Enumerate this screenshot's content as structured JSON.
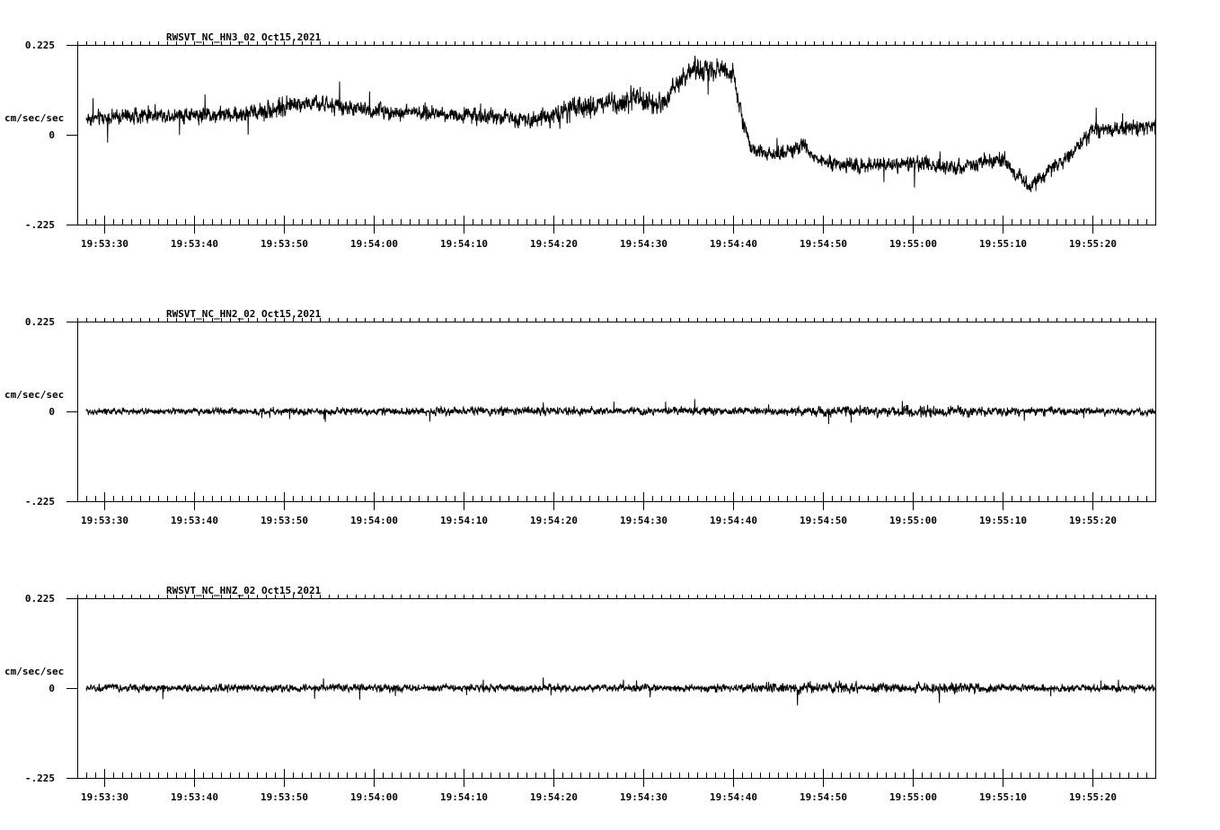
{
  "colors": {
    "background": "#ffffff",
    "trace": "#000000"
  },
  "chart_data": [
    {
      "type": "line",
      "title": "RWSVT_NC_HN3_02  Oct15,2021",
      "ylabel": "cm/sec/sec",
      "ylim": [
        -0.225,
        0.225
      ],
      "yticks": [
        "0.225",
        "0",
        "-.225"
      ],
      "xlim": [
        "19:53:27",
        "19:55:27"
      ],
      "xticks": [
        "19:53:30",
        "19:53:40",
        "19:53:50",
        "19:54:00",
        "19:54:10",
        "19:54:20",
        "19:54:30",
        "19:54:40",
        "19:54:50",
        "19:55:00",
        "19:55:10",
        "19:55:20"
      ],
      "grid": false,
      "series": [
        {
          "trace_start": "19:53:28",
          "trace_end": "19:55:27",
          "envelope_times": [
            "19:53:28",
            "19:53:35",
            "19:53:45",
            "19:53:50",
            "19:53:52",
            "19:54:00",
            "19:54:10",
            "19:54:17",
            "19:54:20",
            "19:54:28",
            "19:54:32",
            "19:54:35",
            "19:54:39",
            "19:54:40",
            "19:54:41",
            "19:54:42",
            "19:54:44",
            "19:54:48",
            "19:54:50",
            "19:54:55",
            "19:55:00",
            "19:55:05",
            "19:55:10",
            "19:55:13",
            "19:55:17",
            "19:55:20",
            "19:55:25",
            "19:55:27"
          ],
          "mean_values": [
            0.04,
            0.05,
            0.05,
            0.07,
            0.08,
            0.06,
            0.05,
            0.04,
            0.05,
            0.09,
            0.08,
            0.16,
            0.16,
            0.15,
            0.05,
            -0.04,
            -0.05,
            -0.03,
            -0.07,
            -0.08,
            -0.07,
            -0.08,
            -0.06,
            -0.13,
            -0.06,
            0.01,
            0.02,
            0.02
          ],
          "noise_amplitude": [
            0.03,
            0.03,
            0.03,
            0.04,
            0.03,
            0.03,
            0.03,
            0.03,
            0.04,
            0.05,
            0.04,
            0.04,
            0.04,
            0.04,
            0.03,
            0.03,
            0.03,
            0.03,
            0.03,
            0.03,
            0.03,
            0.03,
            0.03,
            0.03,
            0.03,
            0.03,
            0.03,
            0.03
          ]
        }
      ]
    },
    {
      "type": "line",
      "title": "RWSVT_NC_HN2_02  Oct15,2021",
      "ylabel": "cm/sec/sec",
      "ylim": [
        -0.225,
        0.225
      ],
      "yticks": [
        "0.225",
        "0",
        "-.225"
      ],
      "xlim": [
        "19:53:27",
        "19:55:27"
      ],
      "xticks": [
        "19:53:30",
        "19:53:40",
        "19:53:50",
        "19:54:00",
        "19:54:10",
        "19:54:20",
        "19:54:30",
        "19:54:40",
        "19:54:50",
        "19:55:00",
        "19:55:10",
        "19:55:20"
      ],
      "grid": false,
      "series": [
        {
          "trace_start": "19:53:28",
          "trace_end": "19:55:27",
          "envelope_times": [
            "19:53:28",
            "19:54:05",
            "19:54:10",
            "19:54:45",
            "19:54:50",
            "19:55:05",
            "19:55:10",
            "19:55:27"
          ],
          "mean_values": [
            0.0,
            0.0,
            0.002,
            0.0,
            0.0,
            0.0,
            0.0,
            0.0
          ],
          "noise_amplitude": [
            0.012,
            0.014,
            0.016,
            0.014,
            0.02,
            0.02,
            0.016,
            0.012
          ]
        }
      ]
    },
    {
      "type": "line",
      "title": "RWSVT_NC_HNZ_02  Oct15,2021",
      "ylabel": "cm/sec/sec",
      "ylim": [
        -0.225,
        0.225
      ],
      "yticks": [
        "0.225",
        "0",
        "-.225"
      ],
      "xlim": [
        "19:53:27",
        "19:55:27"
      ],
      "xticks": [
        "19:53:30",
        "19:53:40",
        "19:53:50",
        "19:54:00",
        "19:54:10",
        "19:54:20",
        "19:54:30",
        "19:54:40",
        "19:54:50",
        "19:55:00",
        "19:55:10",
        "19:55:20"
      ],
      "grid": false,
      "series": [
        {
          "trace_start": "19:53:28",
          "trace_end": "19:55:27",
          "envelope_times": [
            "19:53:28",
            "19:54:40",
            "19:54:45",
            "19:54:50",
            "19:55:00",
            "19:55:05",
            "19:55:10",
            "19:55:27"
          ],
          "mean_values": [
            0.0,
            0.0,
            0.0,
            0.0,
            0.0,
            0.0,
            0.0,
            0.0
          ],
          "noise_amplitude": [
            0.014,
            0.014,
            0.022,
            0.022,
            0.016,
            0.022,
            0.016,
            0.014
          ]
        }
      ]
    }
  ]
}
